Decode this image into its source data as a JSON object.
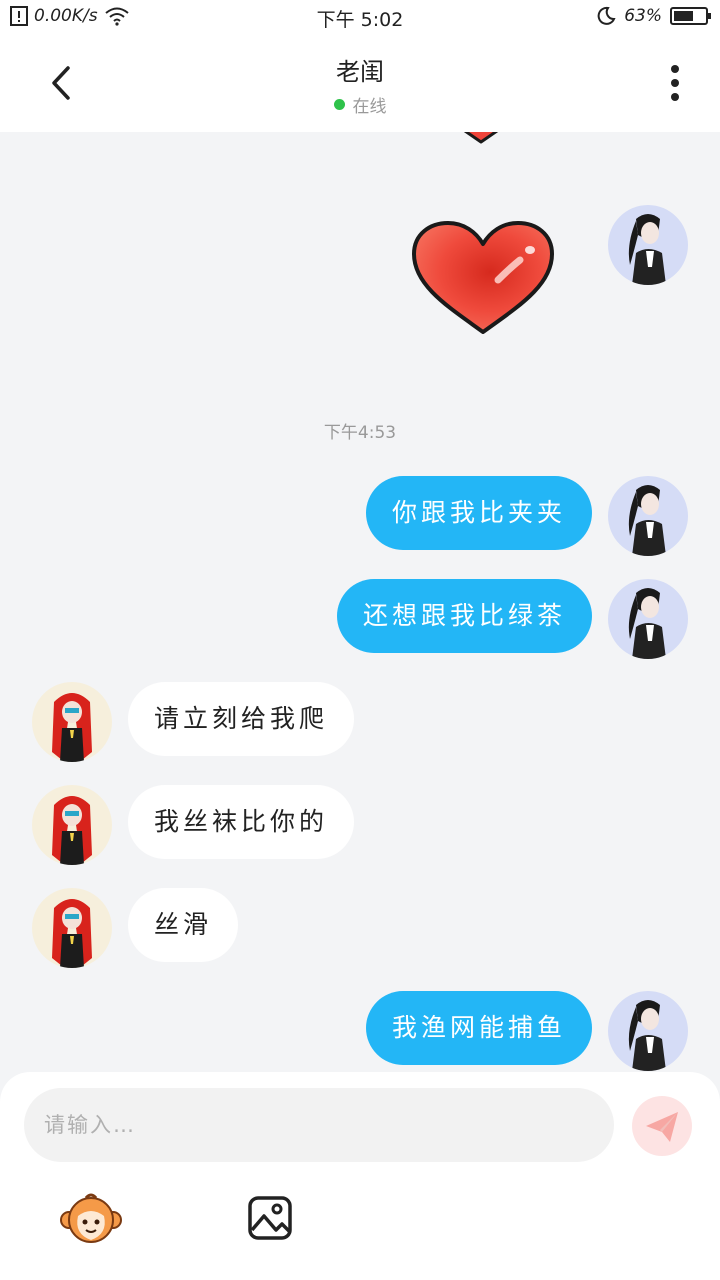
{
  "status_bar": {
    "net_speed": "0.00K/s",
    "time": "下午 5:02",
    "battery_percent": "63%",
    "battery_level": 0.63
  },
  "header": {
    "title": "老闺",
    "status": "在线",
    "status_color": "#2ec24a"
  },
  "chat": {
    "timestamp": "下午4:53",
    "messages": [
      {
        "side": "me",
        "type": "sticker",
        "icon": "heart-sticker"
      },
      {
        "side": "me",
        "text": "你跟我比夹夹"
      },
      {
        "side": "me",
        "text": "还想跟我比绿茶"
      },
      {
        "side": "other",
        "text": "请立刻给我爬"
      },
      {
        "side": "other",
        "text": "我丝袜比你的"
      },
      {
        "side": "other",
        "text": "丝滑"
      },
      {
        "side": "me",
        "text": "我渔网能捕鱼"
      }
    ]
  },
  "composer": {
    "placeholder": "请输入…"
  },
  "colors": {
    "accent": "#23b6f6",
    "background": "#f3f4f6",
    "heart": "#f0443a"
  }
}
